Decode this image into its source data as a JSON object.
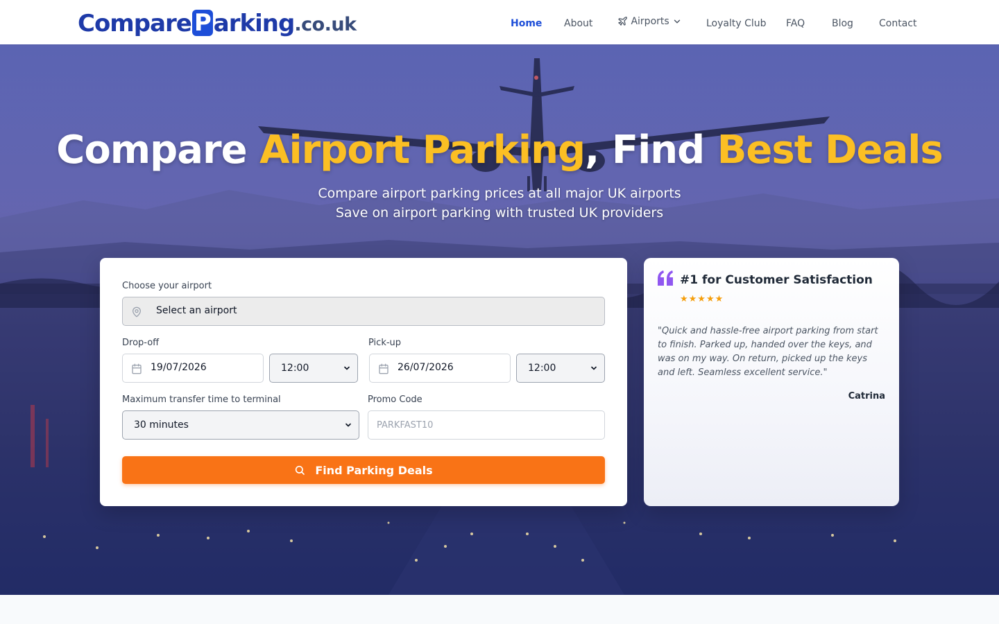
{
  "brand": {
    "logo_main": "Compare",
    "logo_p": "P",
    "logo_rest": "arking",
    "logo_tld": ".co.uk"
  },
  "nav": {
    "home": "Home",
    "about": "About",
    "airports": "Airports",
    "loyalty": "Loyalty Club",
    "faq": "FAQ",
    "blog": "Blog",
    "contact": "Contact"
  },
  "hero": {
    "title_part1": "Compare ",
    "title_highlight1": "Airport Parking",
    "title_part2": ", Find ",
    "title_highlight2": "Best Deals",
    "subtitle_line1": "Compare airport parking prices at all major UK airports",
    "subtitle_line2": "Save on airport parking with trusted UK providers"
  },
  "search": {
    "airport_label": "Choose your airport",
    "airport_value": "Select an airport",
    "dropoff_label": "Drop-off",
    "dropoff_date": "19/07/2026",
    "dropoff_time": "12:00",
    "pickup_label": "Pick-up",
    "pickup_date": "26/07/2026",
    "pickup_time": "12:00",
    "transfer_label": "Maximum transfer time to terminal",
    "transfer_value": "30 minutes",
    "promo_label": "Promo Code",
    "promo_placeholder": "PARKFAST10",
    "button": "Find Parking Deals"
  },
  "testimonial": {
    "title": "#1 for Customer Satisfaction",
    "stars": "★★★★★",
    "rating": 5,
    "quote": "\"Quick and hassle-free airport parking from start to finish. Parked up, handed over the keys, and was on my way. On return, picked up the keys and left. Seamless excellent service.\"",
    "author": "Catrina"
  },
  "colors": {
    "brand_blue": "#1d4ed8",
    "highlight_yellow": "#fbbf24",
    "cta_orange": "#f97316",
    "quote_purple": "#7c3aed",
    "star_gold": "#f59e0b"
  },
  "icons": [
    "plane-icon",
    "chevron-down-icon",
    "map-pin-icon",
    "calendar-icon",
    "search-icon",
    "quote-icon"
  ]
}
